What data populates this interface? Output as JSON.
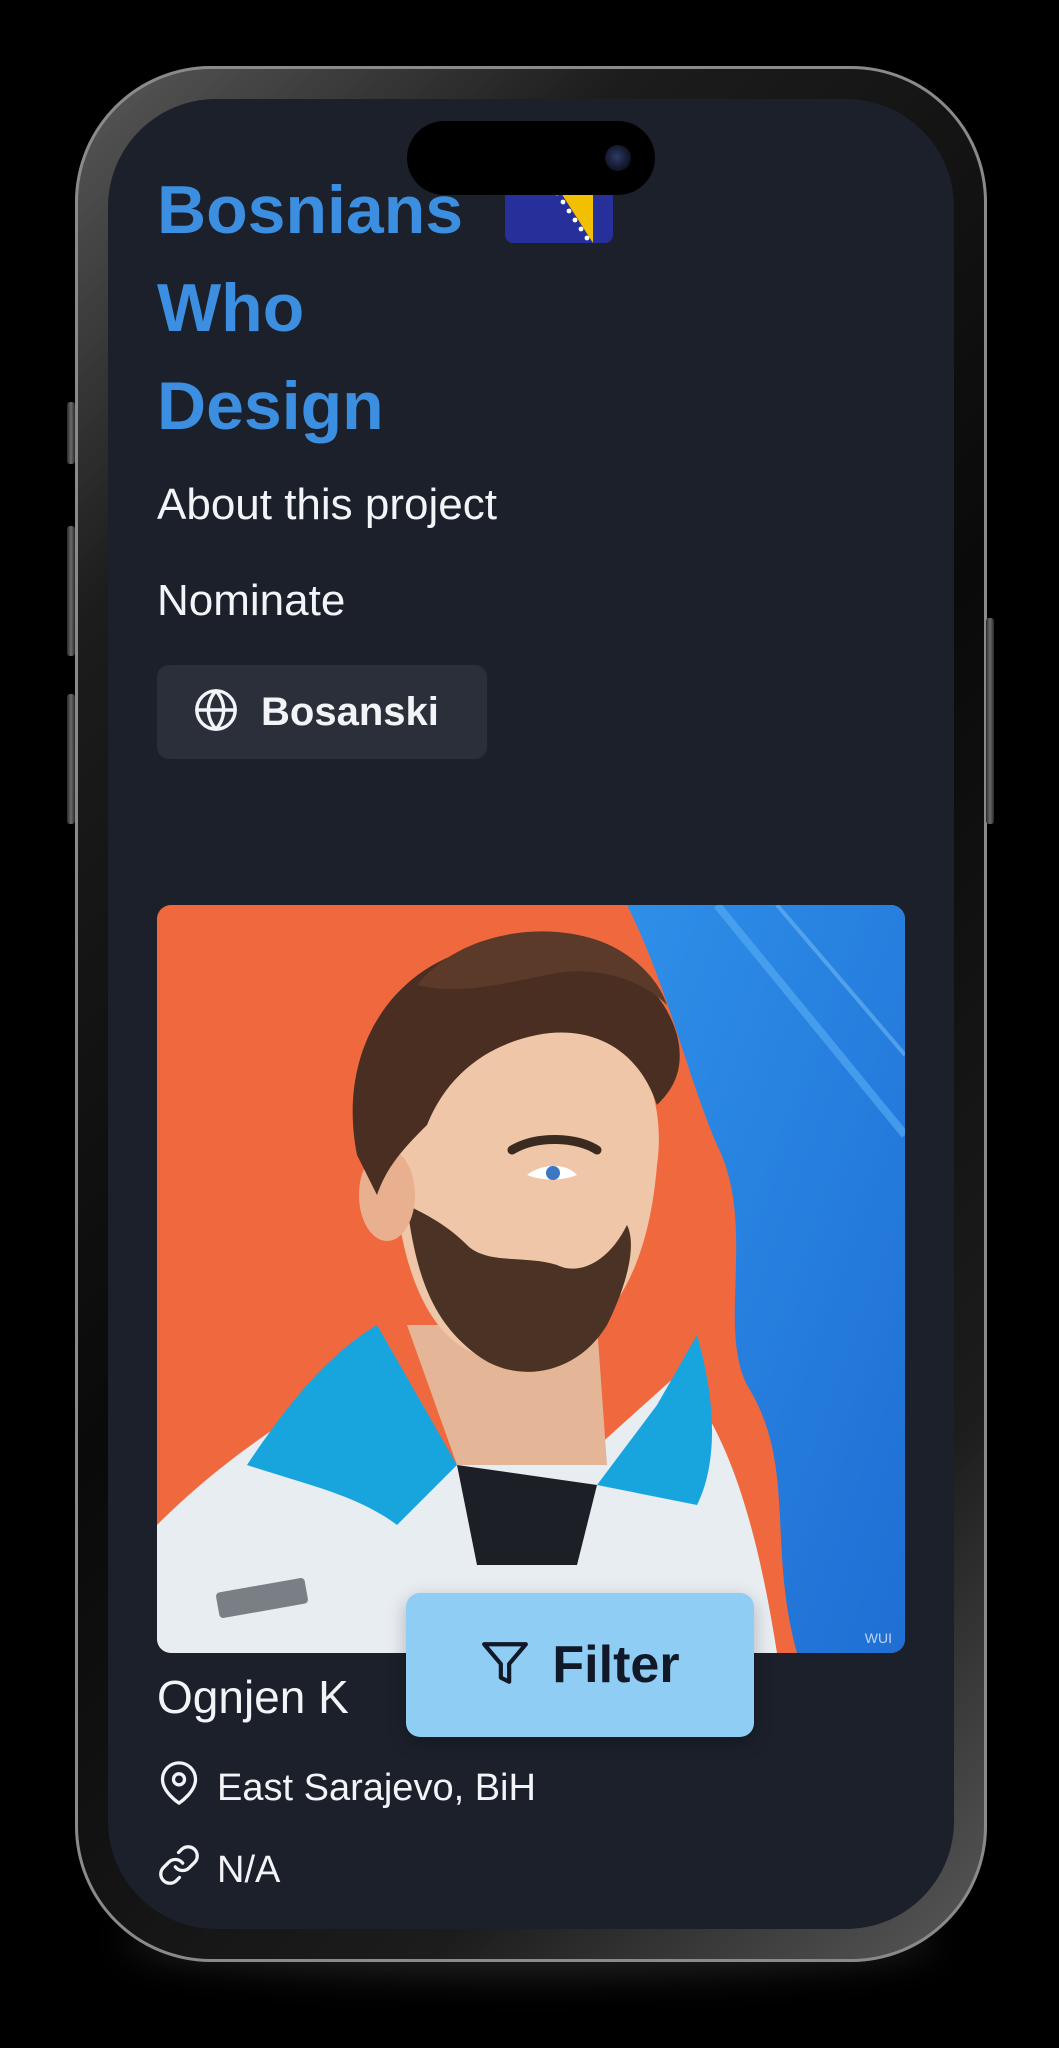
{
  "header": {
    "title_line1": "Bosnians",
    "title_line2": "Who",
    "title_line3": "Design",
    "flag_icon": "bosnia-flag-icon"
  },
  "nav": {
    "about": "About this project",
    "nominate": "Nominate"
  },
  "language": {
    "icon": "globe-icon",
    "label": "Bosanski"
  },
  "designer": {
    "name": "Ognjen K",
    "location": "East Sarajevo, BiH",
    "location_icon": "map-pin-icon",
    "website": "N/A",
    "website_icon": "link-icon",
    "photo_description_icon": "avatar"
  },
  "filter": {
    "icon": "funnel-icon",
    "label": "Filter"
  },
  "colors": {
    "background": "#1b202a",
    "title": "#3c8fe0",
    "text": "#f2f4f7",
    "button_bg": "#2a2f39",
    "filter_bg": "#90cdf4"
  }
}
